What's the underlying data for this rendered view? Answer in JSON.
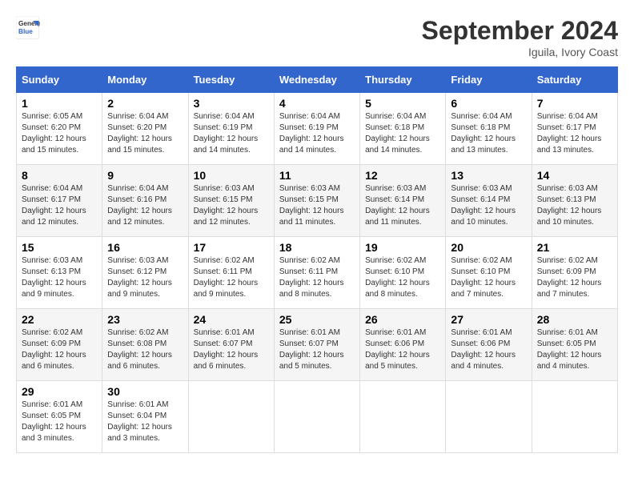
{
  "header": {
    "logo_line1": "General",
    "logo_line2": "Blue",
    "month": "September 2024",
    "location": "Iguila, Ivory Coast"
  },
  "weekdays": [
    "Sunday",
    "Monday",
    "Tuesday",
    "Wednesday",
    "Thursday",
    "Friday",
    "Saturday"
  ],
  "weeks": [
    [
      {
        "day": "1",
        "sunrise": "6:05 AM",
        "sunset": "6:20 PM",
        "daylight": "12 hours and 15 minutes."
      },
      {
        "day": "2",
        "sunrise": "6:04 AM",
        "sunset": "6:20 PM",
        "daylight": "12 hours and 15 minutes."
      },
      {
        "day": "3",
        "sunrise": "6:04 AM",
        "sunset": "6:19 PM",
        "daylight": "12 hours and 14 minutes."
      },
      {
        "day": "4",
        "sunrise": "6:04 AM",
        "sunset": "6:19 PM",
        "daylight": "12 hours and 14 minutes."
      },
      {
        "day": "5",
        "sunrise": "6:04 AM",
        "sunset": "6:18 PM",
        "daylight": "12 hours and 14 minutes."
      },
      {
        "day": "6",
        "sunrise": "6:04 AM",
        "sunset": "6:18 PM",
        "daylight": "12 hours and 13 minutes."
      },
      {
        "day": "7",
        "sunrise": "6:04 AM",
        "sunset": "6:17 PM",
        "daylight": "12 hours and 13 minutes."
      }
    ],
    [
      {
        "day": "8",
        "sunrise": "6:04 AM",
        "sunset": "6:17 PM",
        "daylight": "12 hours and 12 minutes."
      },
      {
        "day": "9",
        "sunrise": "6:04 AM",
        "sunset": "6:16 PM",
        "daylight": "12 hours and 12 minutes."
      },
      {
        "day": "10",
        "sunrise": "6:03 AM",
        "sunset": "6:15 PM",
        "daylight": "12 hours and 12 minutes."
      },
      {
        "day": "11",
        "sunrise": "6:03 AM",
        "sunset": "6:15 PM",
        "daylight": "12 hours and 11 minutes."
      },
      {
        "day": "12",
        "sunrise": "6:03 AM",
        "sunset": "6:14 PM",
        "daylight": "12 hours and 11 minutes."
      },
      {
        "day": "13",
        "sunrise": "6:03 AM",
        "sunset": "6:14 PM",
        "daylight": "12 hours and 10 minutes."
      },
      {
        "day": "14",
        "sunrise": "6:03 AM",
        "sunset": "6:13 PM",
        "daylight": "12 hours and 10 minutes."
      }
    ],
    [
      {
        "day": "15",
        "sunrise": "6:03 AM",
        "sunset": "6:13 PM",
        "daylight": "12 hours and 9 minutes."
      },
      {
        "day": "16",
        "sunrise": "6:03 AM",
        "sunset": "6:12 PM",
        "daylight": "12 hours and 9 minutes."
      },
      {
        "day": "17",
        "sunrise": "6:02 AM",
        "sunset": "6:11 PM",
        "daylight": "12 hours and 9 minutes."
      },
      {
        "day": "18",
        "sunrise": "6:02 AM",
        "sunset": "6:11 PM",
        "daylight": "12 hours and 8 minutes."
      },
      {
        "day": "19",
        "sunrise": "6:02 AM",
        "sunset": "6:10 PM",
        "daylight": "12 hours and 8 minutes."
      },
      {
        "day": "20",
        "sunrise": "6:02 AM",
        "sunset": "6:10 PM",
        "daylight": "12 hours and 7 minutes."
      },
      {
        "day": "21",
        "sunrise": "6:02 AM",
        "sunset": "6:09 PM",
        "daylight": "12 hours and 7 minutes."
      }
    ],
    [
      {
        "day": "22",
        "sunrise": "6:02 AM",
        "sunset": "6:09 PM",
        "daylight": "12 hours and 6 minutes."
      },
      {
        "day": "23",
        "sunrise": "6:02 AM",
        "sunset": "6:08 PM",
        "daylight": "12 hours and 6 minutes."
      },
      {
        "day": "24",
        "sunrise": "6:01 AM",
        "sunset": "6:07 PM",
        "daylight": "12 hours and 6 minutes."
      },
      {
        "day": "25",
        "sunrise": "6:01 AM",
        "sunset": "6:07 PM",
        "daylight": "12 hours and 5 minutes."
      },
      {
        "day": "26",
        "sunrise": "6:01 AM",
        "sunset": "6:06 PM",
        "daylight": "12 hours and 5 minutes."
      },
      {
        "day": "27",
        "sunrise": "6:01 AM",
        "sunset": "6:06 PM",
        "daylight": "12 hours and 4 minutes."
      },
      {
        "day": "28",
        "sunrise": "6:01 AM",
        "sunset": "6:05 PM",
        "daylight": "12 hours and 4 minutes."
      }
    ],
    [
      {
        "day": "29",
        "sunrise": "6:01 AM",
        "sunset": "6:05 PM",
        "daylight": "12 hours and 3 minutes."
      },
      {
        "day": "30",
        "sunrise": "6:01 AM",
        "sunset": "6:04 PM",
        "daylight": "12 hours and 3 minutes."
      },
      null,
      null,
      null,
      null,
      null
    ]
  ]
}
